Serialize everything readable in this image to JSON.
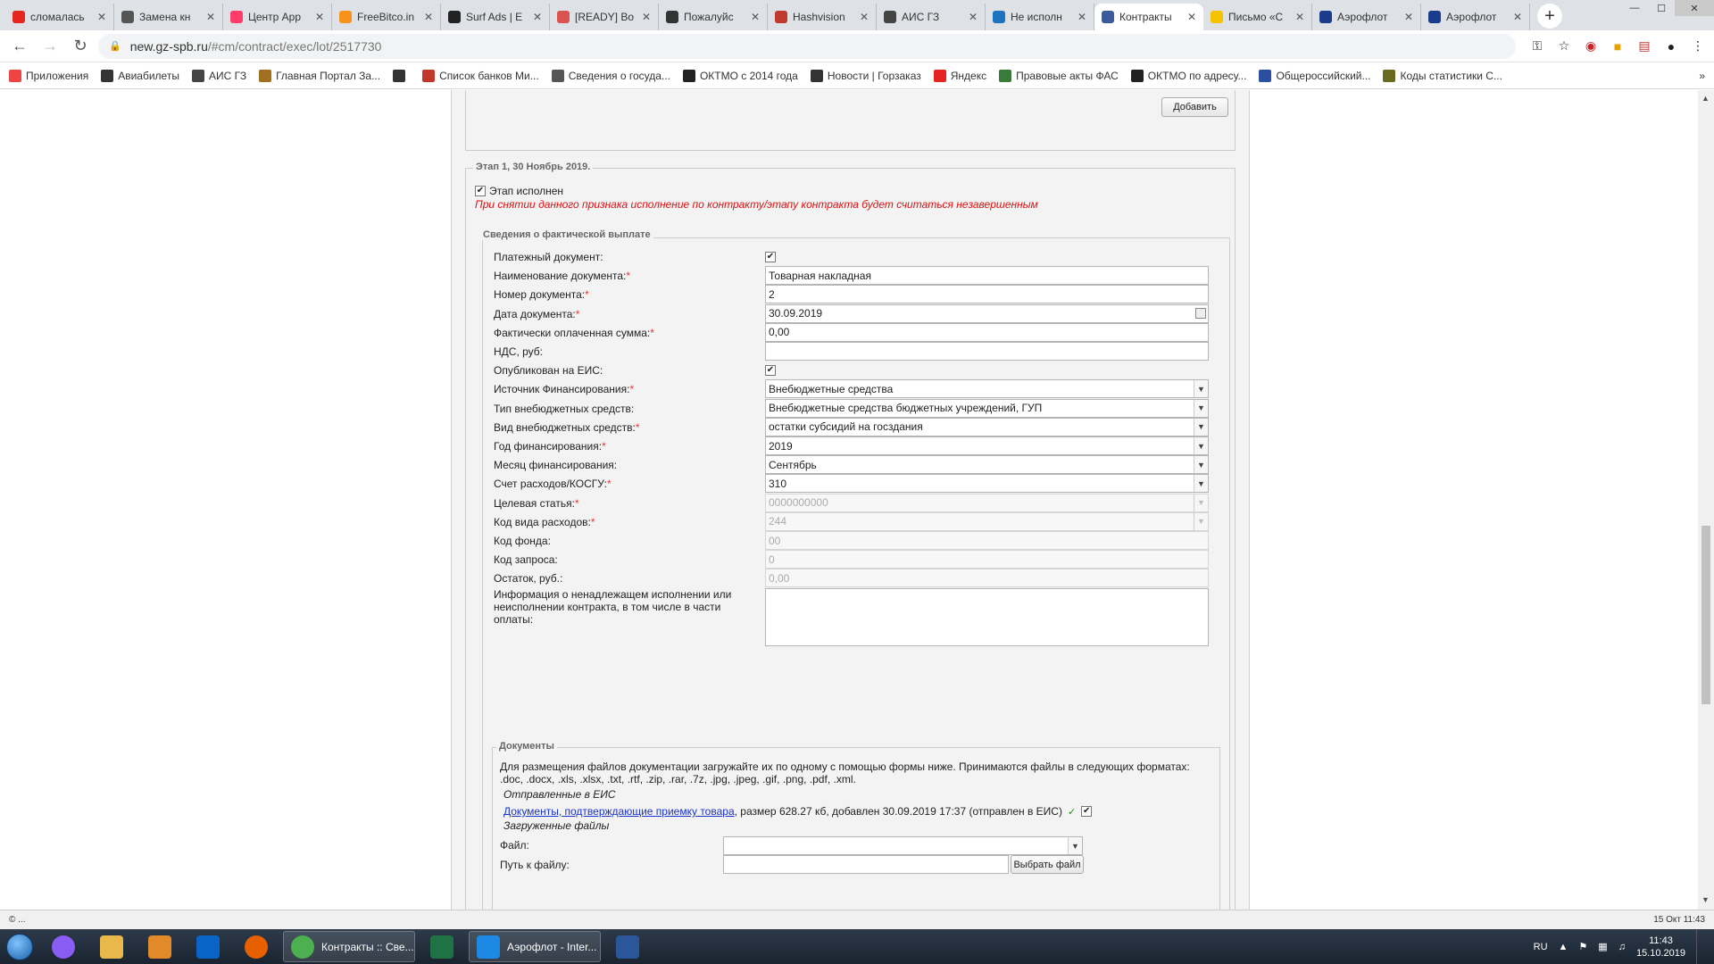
{
  "browser": {
    "tabs": [
      {
        "title": "сломалась",
        "color": "#e52620"
      },
      {
        "title": "Замена кн",
        "color": "#555555"
      },
      {
        "title": "Центр App",
        "color": "#ff3b6b"
      },
      {
        "title": "FreeBitco.in",
        "color": "#f7931a"
      },
      {
        "title": "Surf Ads | E",
        "color": "#222222"
      },
      {
        "title": "[READY] Bo",
        "color": "#d9534f"
      },
      {
        "title": "Пожалуйс",
        "color": "#333333"
      },
      {
        "title": "Hashvision",
        "color": "#c0392b"
      },
      {
        "title": "АИС ГЗ",
        "color": "#444444"
      },
      {
        "title": "Не исполн",
        "color": "#1e73be"
      },
      {
        "title": "Контракты",
        "color": "#3a5a9a"
      },
      {
        "title": "Письмо «С",
        "color": "#f5c400"
      },
      {
        "title": "Аэрофлот",
        "color": "#1b3c8c"
      },
      {
        "title": "Аэрофлот",
        "color": "#1b3c8c"
      }
    ],
    "active_tab_index": 10,
    "url_host": "new.gz-spb.ru",
    "url_path": "/#cm/contract/exec/lot/2517730",
    "bookmarks": [
      {
        "label": "Приложения",
        "color": "#e44"
      },
      {
        "label": "Авиабилеты",
        "color": "#333"
      },
      {
        "label": "АИС ГЗ",
        "color": "#444"
      },
      {
        "label": "Главная Портал За...",
        "color": "#a07020"
      },
      {
        "label": "",
        "color": "#333"
      },
      {
        "label": "Список банков Ми...",
        "color": "#c0392b"
      },
      {
        "label": "Сведения о госуда...",
        "color": "#555"
      },
      {
        "label": "ОКТМО с 2014 года",
        "color": "#222"
      },
      {
        "label": "Новости | Горзаказ",
        "color": "#333"
      },
      {
        "label": "Яндекс",
        "color": "#e52620"
      },
      {
        "label": "Правовые акты ФАС",
        "color": "#3a7a3a"
      },
      {
        "label": "ОКТМО по адресу...",
        "color": "#222"
      },
      {
        "label": "Общероссийский...",
        "color": "#2a4fa0"
      },
      {
        "label": "Коды статистики С...",
        "color": "#6a6a20"
      }
    ]
  },
  "form": {
    "add_button": "Добавить",
    "stage_title": "Этап 1, 30 Ноябрь 2019.",
    "stage_done_label": "Этап исполнен",
    "stage_done_checked": true,
    "warning": "При снятии данного признака исполнение по контракту/этапу контракта будет считаться незавершенным",
    "payment_section": "Сведения о фактической выплате",
    "fields": [
      {
        "label": "Платежный документ:",
        "required": false,
        "type": "checkbox",
        "value": true
      },
      {
        "label": "Наименование документа:",
        "required": true,
        "type": "text",
        "value": "Товарная накладная"
      },
      {
        "label": "Номер документа:",
        "required": true,
        "type": "text",
        "value": "2"
      },
      {
        "label": "Дата документа:",
        "required": true,
        "type": "date",
        "value": "30.09.2019"
      },
      {
        "label": "Фактически оплаченная сумма:",
        "required": true,
        "type": "text",
        "value": "0,00"
      },
      {
        "label": "НДС, руб:",
        "required": false,
        "type": "text",
        "value": ""
      },
      {
        "label": "Опубликован на ЕИС:",
        "required": false,
        "type": "checkbox",
        "value": true
      },
      {
        "label": "Источник Финансирования:",
        "required": true,
        "type": "select",
        "value": "Внебюджетные средства"
      },
      {
        "label": "Тип внебюджетных средств:",
        "required": false,
        "type": "select",
        "value": "Внебюджетные средства бюджетных учреждений, ГУП"
      },
      {
        "label": "Вид внебюджетных средств:",
        "required": true,
        "type": "select",
        "value": "остатки субсидий на госздания"
      },
      {
        "label": "Год финансирования:",
        "required": true,
        "type": "select",
        "value": "2019"
      },
      {
        "label": "Месяц финансирования:",
        "required": false,
        "type": "select",
        "value": "Сентябрь"
      },
      {
        "label": "Счет расходов/КОСГУ:",
        "required": true,
        "type": "select",
        "value": "310"
      },
      {
        "label": "Целевая статья:",
        "required": true,
        "type": "select-disabled",
        "value": "0000000000"
      },
      {
        "label": "Код вида расходов:",
        "required": true,
        "type": "select-disabled",
        "value": "244"
      },
      {
        "label": "Код фонда:",
        "required": false,
        "type": "text-disabled",
        "value": "00"
      },
      {
        "label": "Код запроса:",
        "required": false,
        "type": "text-disabled",
        "value": "0"
      },
      {
        "label": "Остаток, руб.:",
        "required": false,
        "type": "text-disabled",
        "value": "0,00"
      }
    ],
    "info_label": "Информация о ненадлежащем исполнении или неисполнении контракта, в том числе в части оплаты:",
    "docs": {
      "title": "Документы",
      "hint": "Для размещения файлов документации загружайте их по одному с помощью формы ниже. Принимаются файлы в следующих форматах: .doc, .docx, .xls, .xlsx, .txt, .rtf, .zip, .rar, .7z, .jpg, .jpeg, .gif, .png, .pdf, .xml.",
      "sent_label": "Отправленные в ЕИС",
      "file_link": "Документы, подтверждающие приемку товара",
      "file_meta": ", размер 628.27 кб, добавлен 30.09.2019 17:37 (отправлен в ЕИС)",
      "uploaded_label": "Загруженные файлы",
      "file_label": "Файл:",
      "path_label": "Путь к файлу:",
      "choose_button": "Выбрать файл"
    }
  },
  "statusbar": {
    "left": "© ...",
    "right": "15 Окт 11:43"
  },
  "taskbar": {
    "items": [
      {
        "name": "alice",
        "color": "#8a5cf6"
      },
      {
        "name": "explorer",
        "color": "#e8b84a"
      },
      {
        "name": "media",
        "color": "#e2892a"
      },
      {
        "name": "outlook",
        "color": "#0a64c8"
      },
      {
        "name": "firefox",
        "color": "#e66000"
      },
      {
        "name": "chrome",
        "label": "Контракты :: Све...",
        "color": "#4caf50"
      },
      {
        "name": "excel",
        "color": "#1f7244"
      },
      {
        "name": "ie",
        "label": "Аэрофлот - Inter...",
        "color": "#1e88e5"
      },
      {
        "name": "word",
        "color": "#2b579a"
      }
    ],
    "lang": "RU",
    "time": "11:43",
    "date": "15.10.2019"
  }
}
